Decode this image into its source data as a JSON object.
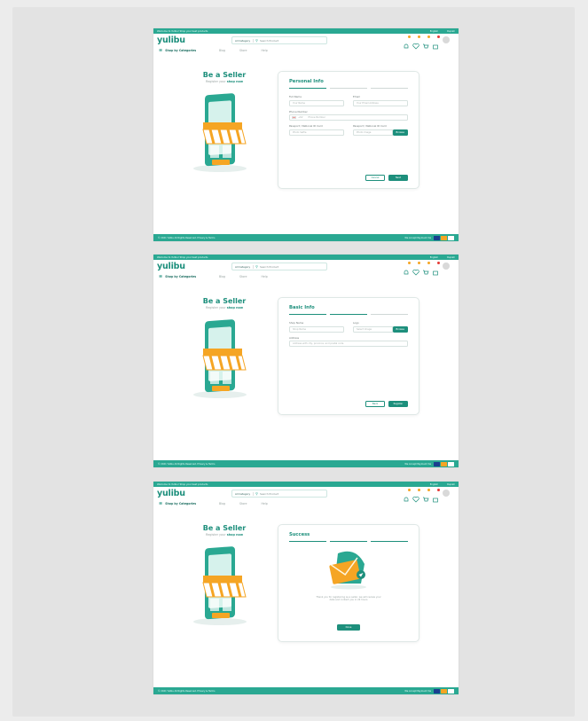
{
  "screens": [
    {
      "topbar": {
        "left": "Welcome to Yulibu! Shop your best products",
        "lang": "English",
        "currency": "Rupiah"
      },
      "logo": "yulibu",
      "search": {
        "category": "All Category",
        "placeholder": "Search Product"
      },
      "nav": {
        "categories": "Shop by Categories",
        "links": [
          "Blog",
          "Store",
          "Help"
        ]
      },
      "hero": {
        "title": "Be a Seller",
        "subtitle_prefix": "Register your",
        "subtitle_em": "shop now"
      },
      "card": {
        "title": "Personal Info",
        "progress": [
          true,
          false,
          false
        ],
        "fields": [
          {
            "label": "Full Name",
            "placeholder": "Your Name"
          },
          {
            "label": "Email",
            "placeholder": "Your Email Address"
          }
        ],
        "phone": {
          "label": "Phone Number",
          "code": "+62",
          "placeholder": "Phone Number"
        },
        "uploads": [
          {
            "label": "Passport / National ID Card",
            "placeholder": "Photo Selfie"
          },
          {
            "label": "Passport / National ID Card",
            "placeholder": "Photo Image",
            "button": "Browse"
          }
        ],
        "secondary": "Cancel",
        "primary": "Next"
      },
      "footer": {
        "left": "© 2021 Yulibu All Rights Reserved. Privacy & Terms",
        "right": "We Accept Payment Via"
      }
    },
    {
      "topbar": {
        "left": "Welcome to Yulibu! Shop your best products",
        "lang": "English",
        "currency": "Rupiah"
      },
      "logo": "yulibu",
      "search": {
        "category": "All Category",
        "placeholder": "Search Product"
      },
      "nav": {
        "categories": "Shop by Categories",
        "links": [
          "Blog",
          "Store",
          "Help"
        ]
      },
      "hero": {
        "title": "Be a Seller",
        "subtitle_prefix": "Register your",
        "subtitle_em": "shop now"
      },
      "card": {
        "title": "Basic Info",
        "progress": [
          true,
          true,
          false
        ],
        "shop": {
          "label": "Shop Name",
          "placeholder": "Shop Name"
        },
        "logo": {
          "label": "Logo",
          "placeholder": "Select Image",
          "button": "Browse"
        },
        "address": {
          "label": "Address",
          "placeholder": "Address with city, province, and postal code"
        },
        "secondary": "Back",
        "primary": "Register"
      },
      "footer": {
        "left": "© 2021 Yulibu All Rights Reserved. Privacy & Terms",
        "right": "We Accept Payment Via"
      }
    },
    {
      "topbar": {
        "left": "Welcome to Yulibu! Shop your best products",
        "lang": "English",
        "currency": "Rupiah"
      },
      "logo": "yulibu",
      "search": {
        "category": "All Category",
        "placeholder": "Search Product"
      },
      "nav": {
        "categories": "Shop by Categories",
        "links": [
          "Blog",
          "Store",
          "Help"
        ]
      },
      "hero": {
        "title": "Be a Seller",
        "subtitle_prefix": "Register your",
        "subtitle_em": "shop now"
      },
      "card": {
        "title": "Success",
        "progress": [
          true,
          true,
          true
        ],
        "message": "Thank you for registering as a seller, we will review your data and contact you in 24 hours",
        "primary": "Done"
      },
      "footer": {
        "left": "© 2021 Yulibu All Rights Reserved. Privacy & Terms",
        "right": "We Accept Payment Via"
      }
    }
  ],
  "colors": {
    "brand": "#1d8f7c",
    "topbar": "#2aa892",
    "accent": "#f5a524"
  }
}
